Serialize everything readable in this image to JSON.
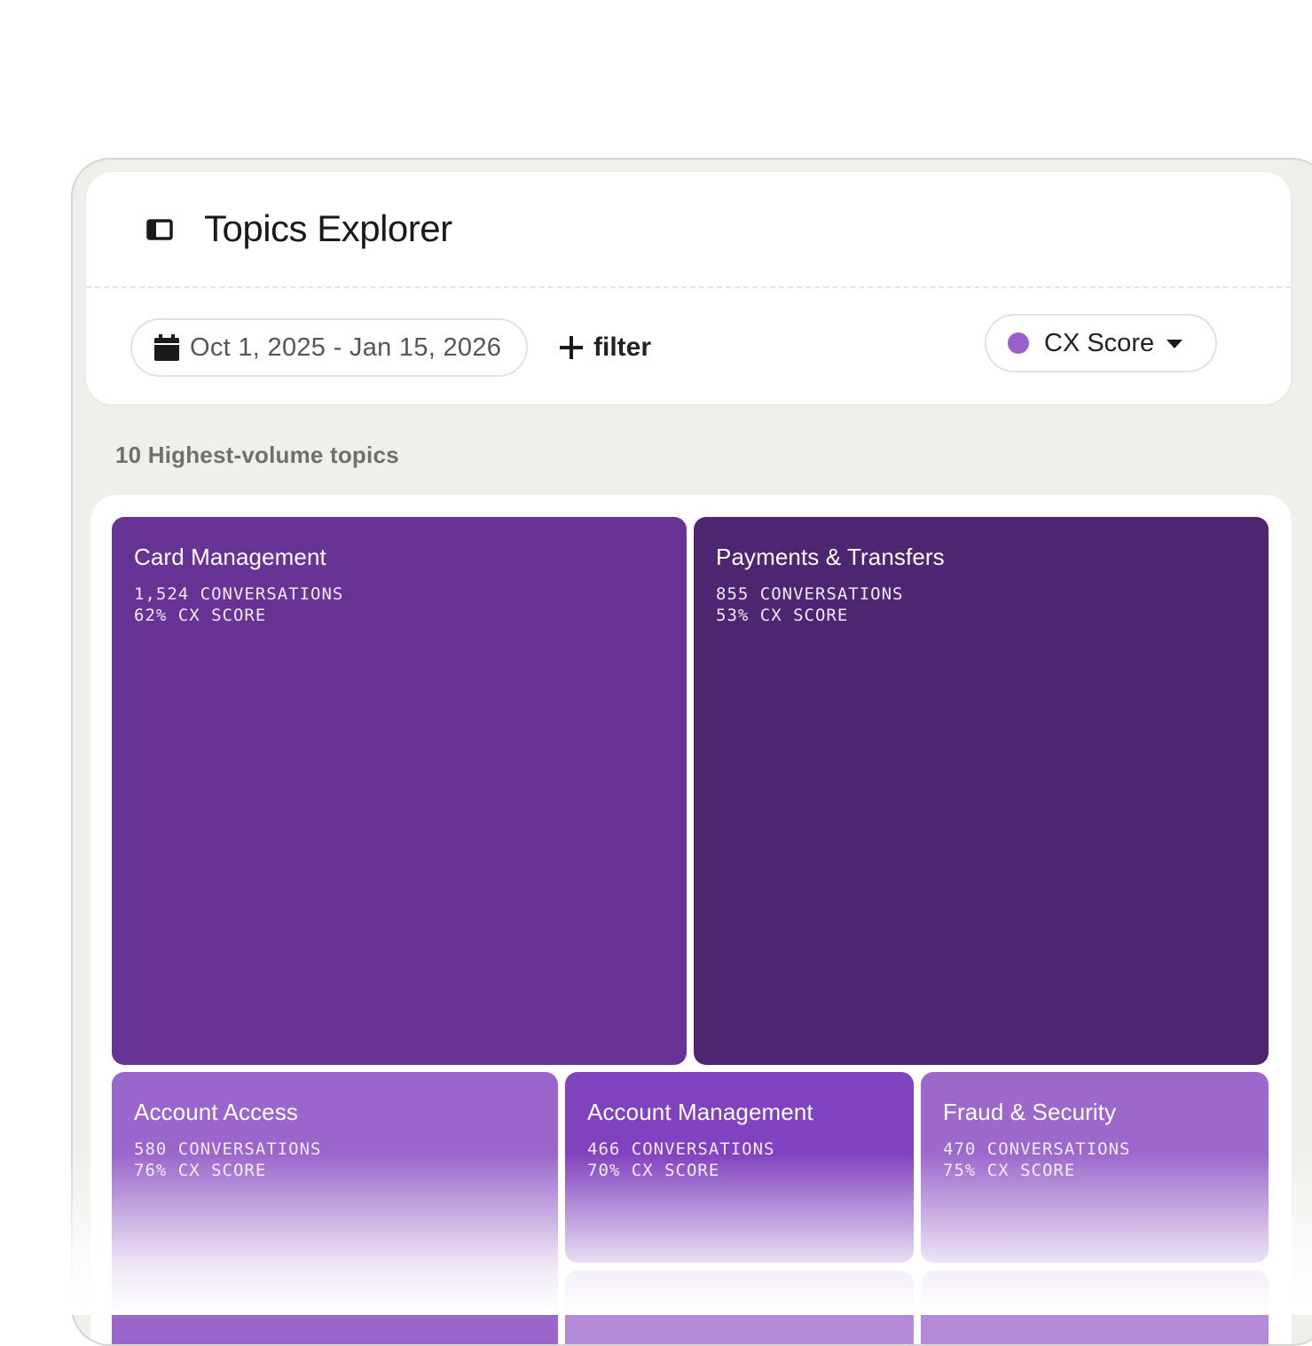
{
  "header": {
    "title": "Topics Explorer",
    "sidebar_toggle_icon": "sidebar-toggle-icon"
  },
  "toolbar": {
    "date_range": "Oct 1, 2025 - Jan 15, 2026",
    "calendar_icon": "calendar-icon",
    "add_filter_label": "filter",
    "metric_label": "CX Score",
    "metric_color": "#9a60cc"
  },
  "section": {
    "label": "10 Highest-volume topics"
  },
  "topics": [
    {
      "name": "Card Management",
      "conversations": "1,524 CONVERSATIONS",
      "cx": "62% CX SCORE",
      "color": "#673395"
    },
    {
      "name": "Payments & Transfers",
      "conversations": "855 CONVERSATIONS",
      "cx": "53% CX SCORE",
      "color": "#4e2571"
    },
    {
      "name": "Account Access",
      "conversations": "580 CONVERSATIONS",
      "cx": "76% CX SCORE",
      "color": "#9a66cb"
    },
    {
      "name": "Account Management",
      "conversations": "466 CONVERSATIONS",
      "cx": "70% CX SCORE",
      "color": "#8042be"
    },
    {
      "name": "Fraud & Security",
      "conversations": "470 CONVERSATIONS",
      "cx": "75% CX SCORE",
      "color": "#9c68cc"
    }
  ]
}
